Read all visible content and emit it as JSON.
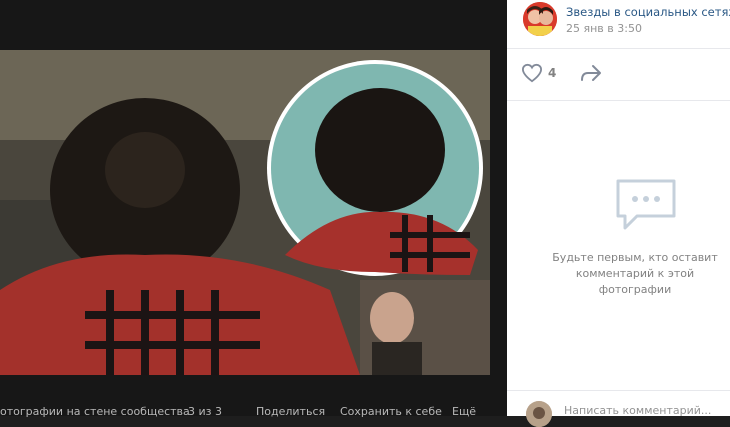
{
  "viewer": {
    "caption": "отографии на стене сообщества",
    "counter": "3 из 3",
    "actions": {
      "share": "Поделиться",
      "save": "Сохранить к себе",
      "more": "Ещё"
    }
  },
  "post": {
    "author": "Звезды в социальных сетях",
    "date": "25 янв в 3:50",
    "likes": "4"
  },
  "comments": {
    "empty_line1": "Будьте первым, кто оставит",
    "empty_line2": "комментарий к этой фотографии",
    "input_placeholder": "Написать комментарий..."
  },
  "icons": {
    "like": "heart-icon",
    "share": "share-arrow-icon",
    "comments": "comment-bubble-icon"
  },
  "colors": {
    "link": "#2a5885",
    "muted": "#939393",
    "icon": "#c5d0db"
  }
}
